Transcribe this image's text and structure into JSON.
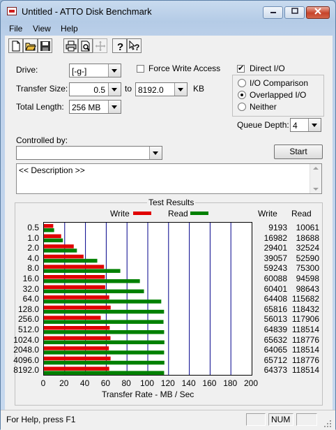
{
  "window": {
    "title": "Untitled - ATTO Disk Benchmark"
  },
  "menu": [
    "File",
    "View",
    "Help"
  ],
  "toolbar_icons": [
    "new-document-icon",
    "open-folder-icon",
    "save-icon",
    "print-icon",
    "print-preview-icon",
    "move-icon",
    "help-icon",
    "context-help-icon"
  ],
  "drive": {
    "label": "Drive:",
    "value": "[-g-]"
  },
  "force_write": {
    "label": "Force Write Access",
    "checked": false
  },
  "direct_io": {
    "label": "Direct I/O",
    "checked": true
  },
  "transfer": {
    "label": "Transfer Size:",
    "from": "0.5",
    "to_label": "to",
    "to": "8192.0",
    "unit": "KB"
  },
  "total_length": {
    "label": "Total Length:",
    "value": "256 MB"
  },
  "io_mode": {
    "options": [
      "I/O Comparison",
      "Overlapped I/O",
      "Neither"
    ],
    "selected": "Overlapped I/O"
  },
  "queue_depth": {
    "label": "Queue Depth:",
    "value": "4"
  },
  "controlled_by": {
    "label": "Controlled by:",
    "value": ""
  },
  "start_button": "Start",
  "description": "<< Description >>",
  "results": {
    "title": "Test Results",
    "write_label": "Write",
    "read_label": "Read",
    "col_write": "Write",
    "col_read": "Read",
    "xlabel": "Transfer Rate - MB / Sec",
    "write_color": "#e00000",
    "read_color": "#008000"
  },
  "chart_data": {
    "type": "bar",
    "orientation": "horizontal",
    "categories": [
      "0.5",
      "1.0",
      "2.0",
      "4.0",
      "8.0",
      "16.0",
      "32.0",
      "64.0",
      "128.0",
      "256.0",
      "512.0",
      "1024.0",
      "2048.0",
      "4096.0",
      "8192.0"
    ],
    "series": [
      {
        "name": "Write",
        "values": [
          9193,
          16982,
          29401,
          39057,
          59243,
          60088,
          60401,
          64408,
          65816,
          56013,
          64839,
          65632,
          64065,
          65712,
          64373
        ]
      },
      {
        "name": "Read",
        "values": [
          10061,
          18688,
          32524,
          52590,
          75300,
          94598,
          98643,
          115682,
          118432,
          117906,
          118514,
          118776,
          118514,
          118776,
          118514
        ]
      }
    ],
    "xlabel": "Transfer Rate - MB / Sec",
    "xlim": [
      0,
      200
    ],
    "x_ticks": [
      "0",
      "20",
      "40",
      "60",
      "80",
      "100",
      "120",
      "140",
      "160",
      "180",
      "200"
    ]
  },
  "status": {
    "text": "For Help, press F1",
    "num": "NUM"
  }
}
